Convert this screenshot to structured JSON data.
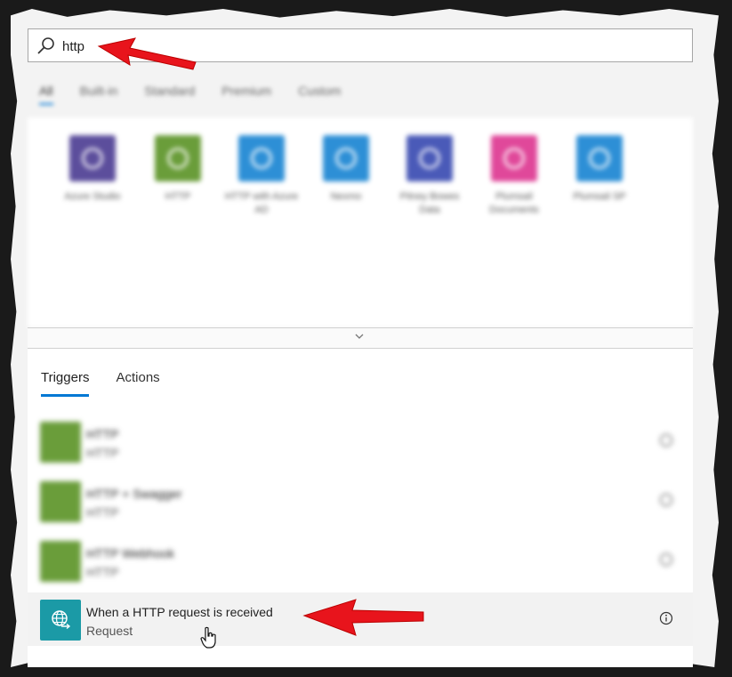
{
  "search": {
    "value": "http",
    "placeholder": ""
  },
  "filter_tabs": [
    "All",
    "Built-in",
    "Standard",
    "Premium",
    "Custom"
  ],
  "connectors": [
    {
      "label": "Azure Studio",
      "color": "#5c4e9c"
    },
    {
      "label": "HTTP",
      "color": "#6a9d3a"
    },
    {
      "label": "HTTP with Azure AD",
      "color": "#2d8fd6"
    },
    {
      "label": "Nexmo",
      "color": "#2d8fd6"
    },
    {
      "label": "Pitney Bowes Data",
      "color": "#4a5ab8"
    },
    {
      "label": "Plumsail Documents",
      "color": "#e0489a"
    },
    {
      "label": "Plumsail SP",
      "color": "#2d8fd6"
    }
  ],
  "tabs": {
    "triggers": "Triggers",
    "actions": "Actions"
  },
  "rows": [
    {
      "title": "HTTP",
      "subtitle": "HTTP"
    },
    {
      "title": "HTTP + Swagger",
      "subtitle": "HTTP"
    },
    {
      "title": "HTTP Webhook",
      "subtitle": "HTTP"
    }
  ],
  "highlighted": {
    "title": "When a HTTP request is received",
    "subtitle": "Request"
  },
  "colors": {
    "accent": "#0078d4",
    "arrow": "#e8141c",
    "request_tile": "#1b9aa6"
  }
}
